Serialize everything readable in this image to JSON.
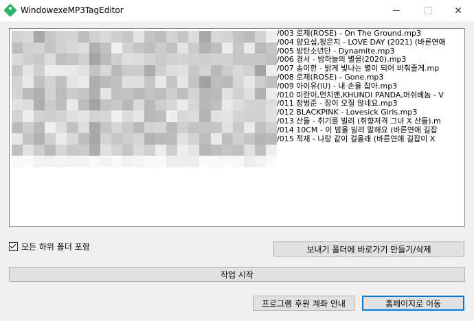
{
  "window": {
    "title": "WindowexeMP3TagEditor",
    "icon": "tag-icon",
    "minimize_glyph": "",
    "close_glyph": "✕"
  },
  "file_list": [
    "/003 로제(ROSE) - On The Ground.mp3",
    "/004 양요섭,정은지 - LOVE DAY (2021) (바른연애",
    "/005 방탄소년단 - Dynamite.mp3",
    "/006 경서 - 밤하늘의 별을(2020).mp3",
    "/007 송이한 - 밝게 빛나는 별이 되어 비춰줄게.mp",
    "/008 로제(ROSE) - Gone.mp3",
    "/009 아이유(IU) - 내 손을 잡아.mp3",
    "/010 미란이,먼치맨,KHUNDI PANDA,머쉬베놈 - V",
    "/011 장범준 - 잠이 오질 않네요.mp3",
    "/012 BLACKPINK - Lovesick Girls.mp3",
    "/013 산들 - 취기를 빌려 (취향저격 그녀 X 산들).m",
    "/014 10CM - 이 밤을 빌려 말해요 (바른연애 길잡",
    "/015 적재 - 나랑 같이 걸을래 (바른연애 길잡이 X"
  ],
  "options": {
    "include_subfolders_label": "모든 하위 폴더 포함",
    "include_subfolders_checked": true
  },
  "buttons": {
    "shortcut_label": "보내기 폴더에 바로가기 만들기/삭제",
    "start_label": "작업 시작",
    "donate_label": "프로그램 후원 계좌 안내",
    "homepage_label": "홈페이지로 이동"
  },
  "colors": {
    "accent": "#0078d7",
    "icon_green": "#2fb36a"
  }
}
